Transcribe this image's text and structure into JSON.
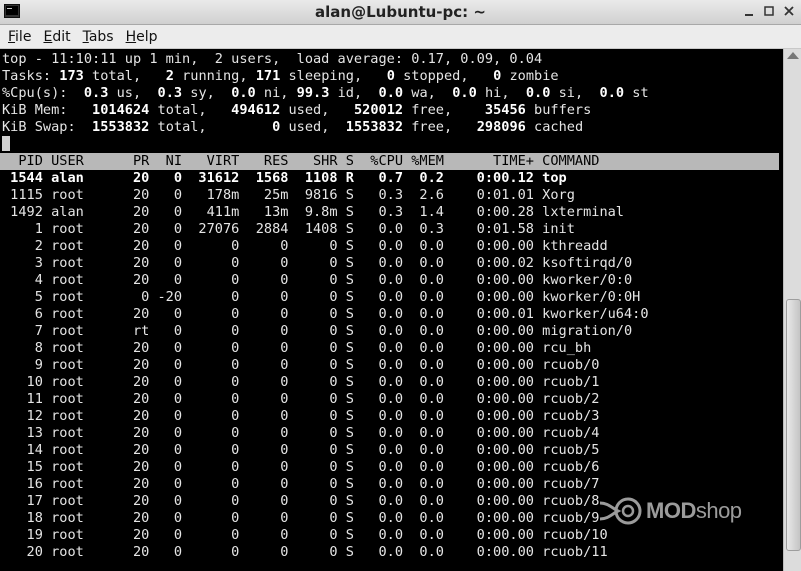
{
  "window": {
    "title": "alan@Lubuntu-pc: ~"
  },
  "menu": [
    {
      "u": "F",
      "rest": "ile"
    },
    {
      "u": "E",
      "rest": "dit"
    },
    {
      "u": "T",
      "rest": "abs"
    },
    {
      "u": "H",
      "rest": "elp"
    }
  ],
  "summary": {
    "top": "top - 11:10:11 up 1 min,  2 users,  load average: 0.17, 0.09, 0.04",
    "tasks": {
      "label": "Tasks:",
      "total": "173",
      "running": "2",
      "sleeping": "171",
      "stopped": "0",
      "zombie": "0"
    },
    "cpu": {
      "label": "%Cpu(s):",
      "us": "0.3",
      "sy": "0.3",
      "ni": "0.0",
      "id": "99.3",
      "wa": "0.0",
      "hi": "0.0",
      "si": "0.0",
      "st": "0.0"
    },
    "mem": {
      "label": "KiB Mem:",
      "total": "1014624",
      "used": "494612",
      "free": "520012",
      "buffers": "35456"
    },
    "swap": {
      "label": "KiB Swap:",
      "total": "1553832",
      "used": "0",
      "free": "1553832",
      "cached": "298096"
    }
  },
  "columns": [
    "PID",
    "USER",
    "PR",
    "NI",
    "VIRT",
    "RES",
    "SHR",
    "S",
    "%CPU",
    "%MEM",
    "TIME+",
    "COMMAND"
  ],
  "processes": [
    [
      "1544",
      "alan",
      "20",
      "0",
      "31612",
      "1568",
      "1108",
      "R",
      "0.7",
      "0.2",
      "0:00.12",
      "top"
    ],
    [
      "1115",
      "root",
      "20",
      "0",
      "178m",
      "25m",
      "9816",
      "S",
      "0.3",
      "2.6",
      "0:01.01",
      "Xorg"
    ],
    [
      "1492",
      "alan",
      "20",
      "0",
      "411m",
      "13m",
      "9.8m",
      "S",
      "0.3",
      "1.4",
      "0:00.28",
      "lxterminal"
    ],
    [
      "1",
      "root",
      "20",
      "0",
      "27076",
      "2884",
      "1408",
      "S",
      "0.0",
      "0.3",
      "0:01.58",
      "init"
    ],
    [
      "2",
      "root",
      "20",
      "0",
      "0",
      "0",
      "0",
      "S",
      "0.0",
      "0.0",
      "0:00.00",
      "kthreadd"
    ],
    [
      "3",
      "root",
      "20",
      "0",
      "0",
      "0",
      "0",
      "S",
      "0.0",
      "0.0",
      "0:00.02",
      "ksoftirqd/0"
    ],
    [
      "4",
      "root",
      "20",
      "0",
      "0",
      "0",
      "0",
      "S",
      "0.0",
      "0.0",
      "0:00.00",
      "kworker/0:0"
    ],
    [
      "5",
      "root",
      "0",
      "-20",
      "0",
      "0",
      "0",
      "S",
      "0.0",
      "0.0",
      "0:00.00",
      "kworker/0:0H"
    ],
    [
      "6",
      "root",
      "20",
      "0",
      "0",
      "0",
      "0",
      "S",
      "0.0",
      "0.0",
      "0:00.01",
      "kworker/u64:0"
    ],
    [
      "7",
      "root",
      "rt",
      "0",
      "0",
      "0",
      "0",
      "S",
      "0.0",
      "0.0",
      "0:00.00",
      "migration/0"
    ],
    [
      "8",
      "root",
      "20",
      "0",
      "0",
      "0",
      "0",
      "S",
      "0.0",
      "0.0",
      "0:00.00",
      "rcu_bh"
    ],
    [
      "9",
      "root",
      "20",
      "0",
      "0",
      "0",
      "0",
      "S",
      "0.0",
      "0.0",
      "0:00.00",
      "rcuob/0"
    ],
    [
      "10",
      "root",
      "20",
      "0",
      "0",
      "0",
      "0",
      "S",
      "0.0",
      "0.0",
      "0:00.00",
      "rcuob/1"
    ],
    [
      "11",
      "root",
      "20",
      "0",
      "0",
      "0",
      "0",
      "S",
      "0.0",
      "0.0",
      "0:00.00",
      "rcuob/2"
    ],
    [
      "12",
      "root",
      "20",
      "0",
      "0",
      "0",
      "0",
      "S",
      "0.0",
      "0.0",
      "0:00.00",
      "rcuob/3"
    ],
    [
      "13",
      "root",
      "20",
      "0",
      "0",
      "0",
      "0",
      "S",
      "0.0",
      "0.0",
      "0:00.00",
      "rcuob/4"
    ],
    [
      "14",
      "root",
      "20",
      "0",
      "0",
      "0",
      "0",
      "S",
      "0.0",
      "0.0",
      "0:00.00",
      "rcuob/5"
    ],
    [
      "15",
      "root",
      "20",
      "0",
      "0",
      "0",
      "0",
      "S",
      "0.0",
      "0.0",
      "0:00.00",
      "rcuob/6"
    ],
    [
      "16",
      "root",
      "20",
      "0",
      "0",
      "0",
      "0",
      "S",
      "0.0",
      "0.0",
      "0:00.00",
      "rcuob/7"
    ],
    [
      "17",
      "root",
      "20",
      "0",
      "0",
      "0",
      "0",
      "S",
      "0.0",
      "0.0",
      "0:00.00",
      "rcuob/8"
    ],
    [
      "18",
      "root",
      "20",
      "0",
      "0",
      "0",
      "0",
      "S",
      "0.0",
      "0.0",
      "0:00.00",
      "rcuob/9"
    ],
    [
      "19",
      "root",
      "20",
      "0",
      "0",
      "0",
      "0",
      "S",
      "0.0",
      "0.0",
      "0:00.00",
      "rcuob/10"
    ],
    [
      "20",
      "root",
      "20",
      "0",
      "0",
      "0",
      "0",
      "S",
      "0.0",
      "0.0",
      "0:00.00",
      "rcuob/11"
    ]
  ],
  "watermark": {
    "brand": "MOD",
    "suffix": "shop"
  },
  "icons": {
    "window": "terminal-icon",
    "minimize": "minimize-icon",
    "maximize": "maximize-icon",
    "close": "close-icon"
  }
}
